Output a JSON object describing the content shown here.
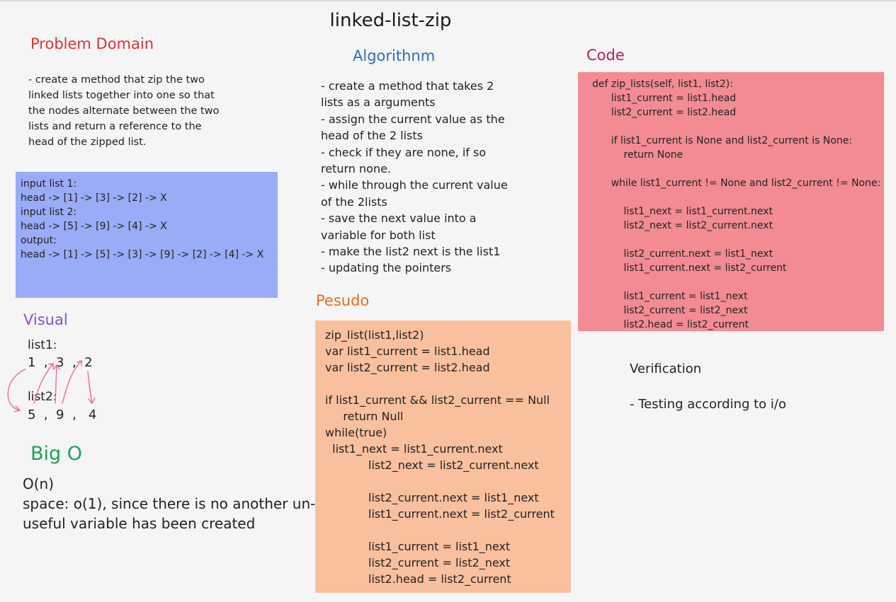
{
  "title": "linked-list-zip",
  "problem_domain": {
    "heading": "Problem Domain",
    "text": "- create a method that zip the two\nlinked lists together into one so that\nthe nodes alternate between the two\nlists and return a reference to the\nhead of the zipped list."
  },
  "io": {
    "lines": [
      "input list 1:",
      "head -> [1] -> [3] -> [2] -> X",
      "",
      "input list 2:",
      "head -> [5] -> [9] -> [4] -> X",
      "",
      "output:",
      "head -> [1] -> [5] -> [3] -> [9] -> [2] -> [4] -> X"
    ]
  },
  "algorithm": {
    "heading": "Algorithnm",
    "lines": [
      "- create a method that takes 2",
      "lists as a arguments",
      "- assign the current value as the",
      "head of the 2 lists",
      "- check if they are none, if so",
      "return none.",
      "- while through the current value",
      "of the 2lists",
      "- save the next value into a",
      "variable for both list",
      "- make the list2 next is the list1",
      "- updating the pointers"
    ]
  },
  "code": {
    "heading": "Code",
    "lines": [
      "def zip_lists(self, list1, list2):",
      "      list1_current = list1.head",
      "      list2_current = list2.head",
      "",
      "      if list1_current is None and list2_current is None:",
      "          return None",
      "",
      "      while list1_current != None and list2_current != None:",
      "",
      "          list1_next = list1_current.next",
      "          list2_next = list2_current.next",
      "",
      "          list2_current.next = list1_next",
      "          list1_current.next = list2_current",
      "",
      "          list1_current = list1_next",
      "          list2_current = list2_next",
      "          list2.head = list2_current"
    ]
  },
  "pesudo": {
    "heading": "Pesudo",
    "lines": [
      "zip_list(list1,list2)",
      "var list1_current = list1.head",
      "var list2_current = list2.head",
      "",
      "if list1_current && list2_current == Null",
      "     return Null",
      "while(true)",
      "  list1_next = list1_current.next",
      "            list2_next = list2_current.next",
      "",
      "            list2_current.next = list1_next",
      "            list1_current.next = list2_current",
      "",
      "            list1_current = list1_next",
      "            list2_current = list2_next",
      "            list2.head = list2_current"
    ]
  },
  "verification": {
    "heading": "Verification",
    "item": "- Testing according to i/o"
  },
  "visual": {
    "heading": "Visual",
    "list1_label": "list1:",
    "list1_nodes": "1  ,  3  ,  2",
    "list2_label": "list2:",
    "list2_nodes": "5  ,  9  ,   4"
  },
  "big_o": {
    "heading": "Big O",
    "time": "O(n)",
    "space_line1": "space: o(1), since there is no another un-",
    "space_line2": "useful variable has been created"
  },
  "colors": {
    "io_box": "#9aabf7",
    "code_box": "#f28b93",
    "pesudo_box": "#f9c09e",
    "arrow": "#e8708a"
  }
}
